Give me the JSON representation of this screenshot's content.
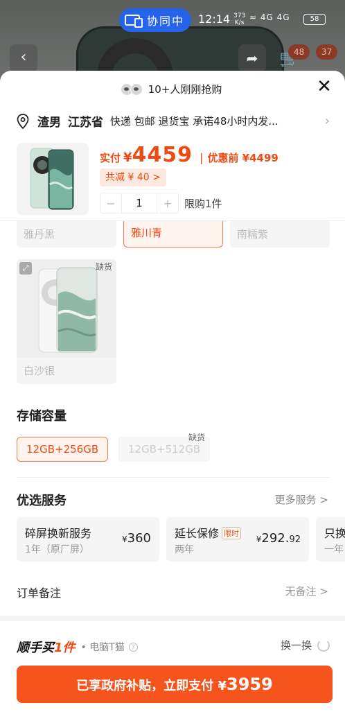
{
  "status_bar": {
    "collab_label": "协同中",
    "time": "12:14",
    "net_speed_value": "373",
    "net_speed_unit": "K/s",
    "signal_text": "4G 4G",
    "battery": "58"
  },
  "background": {
    "cart_badge": "48",
    "msg_badge": "37"
  },
  "sheet": {
    "buyers_text": "10+人刚刚抢购",
    "address": {
      "name": "渣男",
      "province": "江苏省",
      "service": "快递 包邮 退货宝 承诺48小时内发..."
    },
    "price": {
      "label": "实付",
      "currency": "¥",
      "value": "4459",
      "separator": "|",
      "before_label": "优惠前 ¥4499",
      "discount": "共减 ¥ 40 >"
    },
    "quantity": {
      "minus": "−",
      "value": "1",
      "plus": "+",
      "limit": "限购1件"
    },
    "colors": [
      {
        "label": "雅丹黑",
        "selected": false
      },
      {
        "label": "雅川青",
        "selected": true
      },
      {
        "label": "南糯紫",
        "selected": false
      }
    ],
    "silver": {
      "label": "白沙银",
      "oos": "缺货"
    },
    "storage": {
      "title": "存储容量",
      "options": [
        "12GB+256GB",
        "12GB+512GB"
      ],
      "oos": "缺货"
    },
    "services": {
      "title": "优选服务",
      "more": "更多服务 >",
      "cards": [
        {
          "name": "碎屏换新服务",
          "sub": "1年（原厂屏）",
          "yen": "¥",
          "price": "360",
          "cents": ""
        },
        {
          "name": "延长保修",
          "tag": "限时",
          "sub": "两年",
          "yen": "¥",
          "price": "292.",
          "cents": "92"
        },
        {
          "name": "只换",
          "sub": "一年"
        }
      ]
    },
    "remark": {
      "label": "订单备注",
      "value": "无备注 >"
    },
    "bottom": {
      "brand_prefix": "顺手买",
      "brand_suffix": "1件",
      "store": "• 电脑T猫",
      "help": "?",
      "swap": "换一换",
      "pay_text": "已享政府补贴，立即支付",
      "pay_yen": "¥",
      "pay_amount": "3959"
    }
  },
  "colors_theme": {
    "accent": "#f04a12",
    "button": "#f5541c",
    "collab_blue": "#2563eb"
  }
}
